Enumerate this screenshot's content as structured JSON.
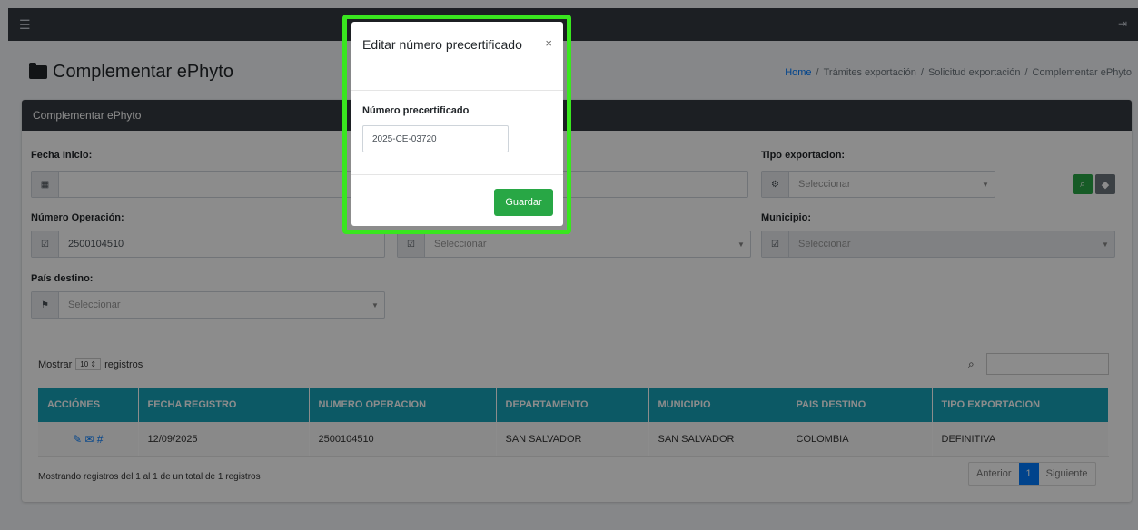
{
  "topbar": {
    "menu_icon": "hamburger-icon",
    "logout_icon": "sign-out-icon"
  },
  "page": {
    "title": "Complementar ePhyto",
    "breadcrumb": [
      "Home",
      "Trámites exportación",
      "Solicitud exportación",
      "Complementar ePhyto"
    ]
  },
  "card": {
    "header": "Complementar ePhyto"
  },
  "filters": {
    "fecha_inicio_label": "Fecha Inicio:",
    "fecha_inicio_value": "",
    "tipo_exportacion_label": "Tipo exportacion:",
    "tipo_exportacion_placeholder": "Seleccionar",
    "numero_operacion_label": "Número Operación:",
    "numero_operacion_value": "2500104510",
    "departamento_placeholder": "Seleccionar",
    "municipio_label": "Municipio:",
    "municipio_placeholder": "Seleccionar",
    "pais_destino_label": "País destino:",
    "pais_destino_placeholder": "Seleccionar"
  },
  "table": {
    "length_prefix": "Mostrar",
    "length_value": "10",
    "length_suffix": "registros",
    "headers": [
      "ACCIÓNES",
      "FECHA REGISTRO",
      "NUMERO OPERACION",
      "DEPARTAMENTO",
      "MUNICIPIO",
      "PAIS DESTINO",
      "TIPO EXPORTACION"
    ],
    "rows": [
      {
        "actions": "✎ ✉ #",
        "fecha": "12/09/2025",
        "numero": "2500104510",
        "departamento": "SAN SALVADOR",
        "municipio": "SAN SALVADOR",
        "pais": "COLOMBIA",
        "tipo": "DEFINITIVA"
      }
    ],
    "info": "Mostrando registros del 1 al 1 de un total de 1 registros",
    "pager_prev": "Anterior",
    "pager_page": "1",
    "pager_next": "Siguiente"
  },
  "modal": {
    "title": "Editar número precertificado",
    "close": "×",
    "label": "Número precertificado",
    "input_value": "2025-CE-03720",
    "save": "Guardar"
  },
  "colors": {
    "navbar": "#343a40",
    "table_header": "#17a2b8",
    "primary": "#007bff",
    "success": "#28a745",
    "highlight": "#39e61f"
  }
}
